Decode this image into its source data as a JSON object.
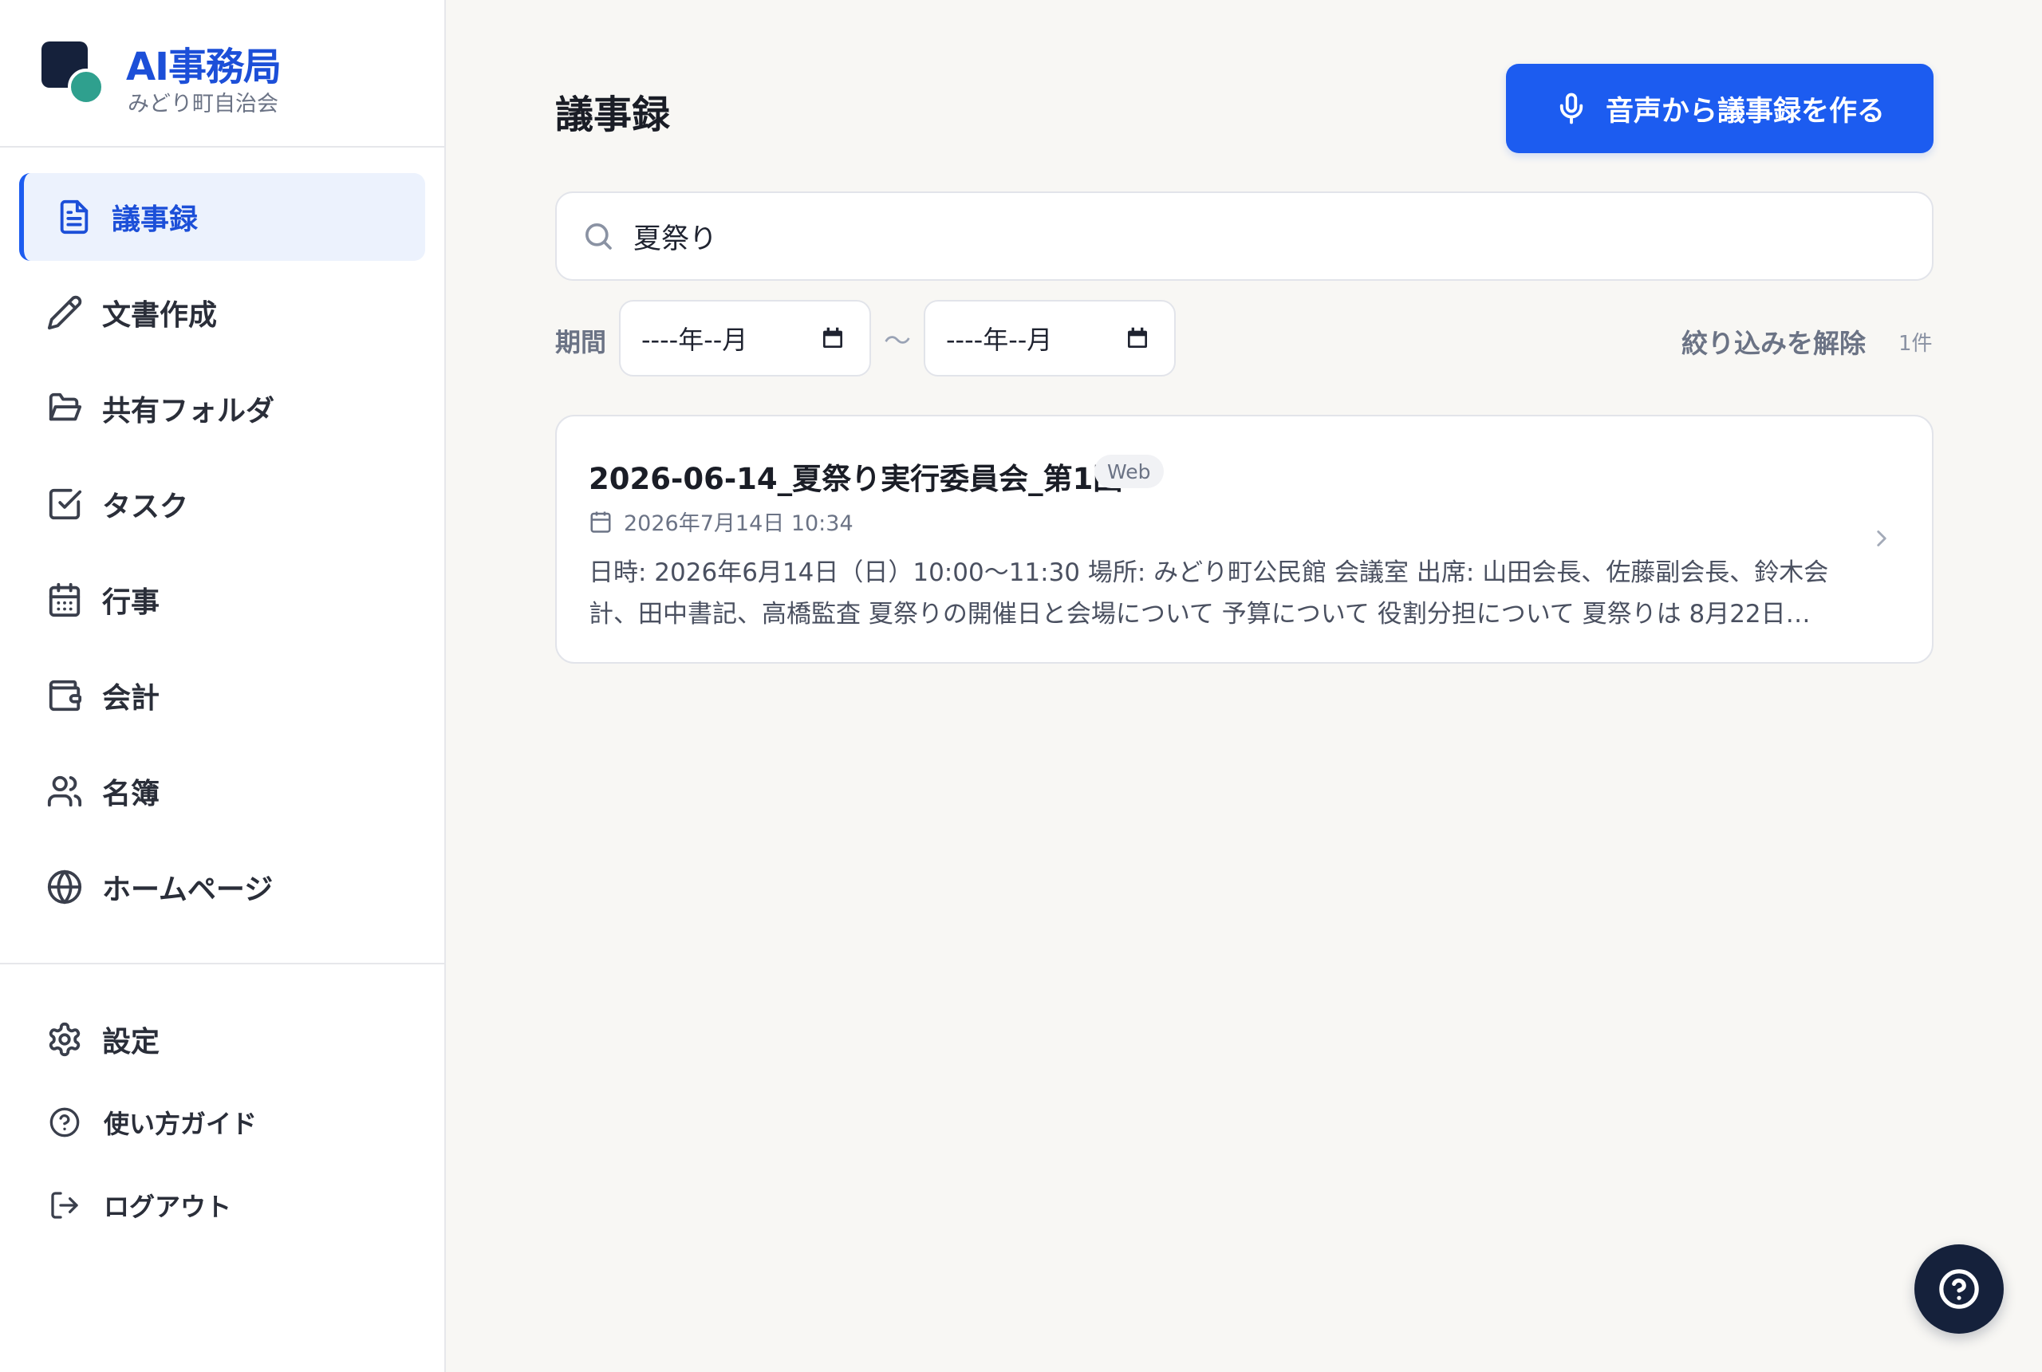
{
  "brand": {
    "title": "AI事務局",
    "subtitle": "みどり町自治会"
  },
  "sidebar": {
    "items": [
      {
        "label": "議事録",
        "icon": "document-icon",
        "active": true
      },
      {
        "label": "文書作成",
        "icon": "pencil-icon"
      },
      {
        "label": "共有フォルダ",
        "icon": "folder-icon"
      },
      {
        "label": "タスク",
        "icon": "checkbox-icon"
      },
      {
        "label": "行事",
        "icon": "calendar-icon"
      },
      {
        "label": "会計",
        "icon": "wallet-icon"
      },
      {
        "label": "名簿",
        "icon": "users-icon"
      },
      {
        "label": "ホームページ",
        "icon": "globe-icon"
      }
    ],
    "bottom_items": [
      {
        "label": "設定",
        "icon": "gear-icon"
      },
      {
        "label": "使い方ガイド",
        "icon": "help-circle-icon"
      },
      {
        "label": "ログアウト",
        "icon": "logout-icon"
      }
    ]
  },
  "main": {
    "title": "議事録",
    "create_button": "音声から議事録を作る",
    "search": {
      "value": "夏祭り"
    },
    "filter": {
      "period_label": "期間",
      "from_placeholder": "----年--月",
      "separator": "〜",
      "to_placeholder": "----年--月",
      "clear_label": "絞り込みを解除",
      "count": "1件"
    },
    "records": [
      {
        "title": "2026-06-14_夏祭り実行委員会_第1回",
        "source_badge": "Web",
        "date": "2026年7月14日 10:34",
        "summary": "日時: 2026年6月14日（日）10:00〜11:30 場所: みどり町公民館 会議室 出席: 山田会長、佐藤副会長、鈴木会計、田中書記、高橋監査 夏祭りの開催日と会場について 予算について 役割分担について 夏祭りは 8月22日…"
      }
    ]
  },
  "colors": {
    "accent": "#1c5cf0",
    "brand_text": "#1c4fd8",
    "logo_dark": "#15213b",
    "logo_teal": "#2fa08e",
    "background": "#f8f7f4"
  }
}
